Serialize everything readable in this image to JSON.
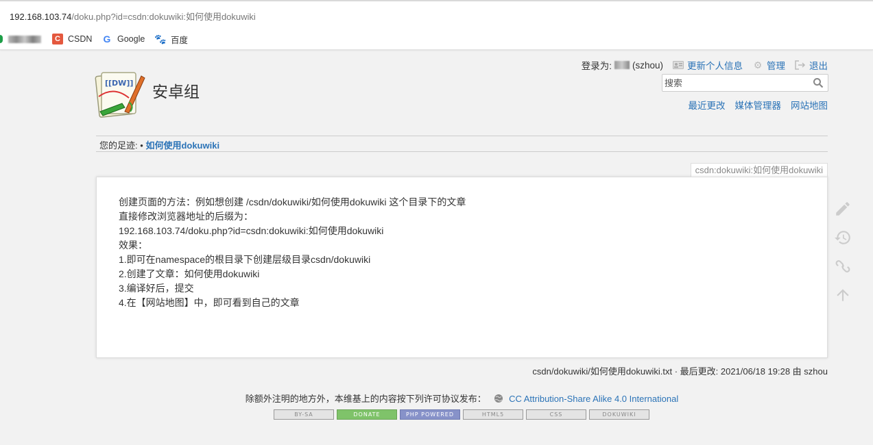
{
  "browser": {
    "url_host": "192.168.103.74",
    "url_path": "/doku.php?id=csdn:dokuwiki:如何使用dokuwiki",
    "bookmarks": [
      {
        "label": "CSDN",
        "icon": "csdn-icon"
      },
      {
        "label": "Google",
        "icon": "google-icon"
      },
      {
        "label": "百度",
        "icon": "baidu-icon"
      }
    ]
  },
  "header": {
    "site_title": "安卓组",
    "user_tools": {
      "logged_in_label": "登录为:",
      "username": "(szhou)",
      "profile": "更新个人信息",
      "admin": "管理",
      "logout": "退出"
    },
    "search_placeholder": "搜索",
    "site_tools": [
      "最近更改",
      "媒体管理器",
      "网站地图"
    ]
  },
  "breadcrumbs": {
    "label": "您的足迹:",
    "separator": "•",
    "items": [
      "如何使用dokuwiki"
    ]
  },
  "page": {
    "page_id": "csdn:dokuwiki:如何使用dokuwiki",
    "content_lines": [
      "创建页面的方法：例如想创建 /csdn/dokuwiki/如何使用dokuwiki 这个目录下的文章",
      "直接修改浏览器地址的后缀为：",
      "192.168.103.74/doku.php?id=csdn:dokuwiki:如何使用dokuwiki",
      "效果：",
      "1.即可在namespace的根目录下创建层级目录csdn/dokuwiki",
      "2.创建了文章：如何使用dokuwiki",
      "3.编译好后，提交",
      "4.在【网站地图】中，即可看到自己的文章"
    ]
  },
  "page_tools": [
    "edit-icon",
    "history-icon",
    "backlinks-icon",
    "back-to-top-icon"
  ],
  "doc_info": "csdn/dokuwiki/如何使用dokuwiki.txt · 最后更改: 2021/06/18 19:28 由 szhou",
  "footer": {
    "license_text": "除额外注明的地方外，本维基上的内容按下列许可协议发布：",
    "license_link": "CC Attribution-Share Alike 4.0 International",
    "badges": [
      "BY-SA",
      "DONATE",
      "PHP POWERED",
      "HTML5",
      "CSS",
      "DOKUWIKI"
    ]
  },
  "colors": {
    "link": "#2b73b7",
    "background": "#f2f2f2",
    "page": "#ffffff"
  }
}
